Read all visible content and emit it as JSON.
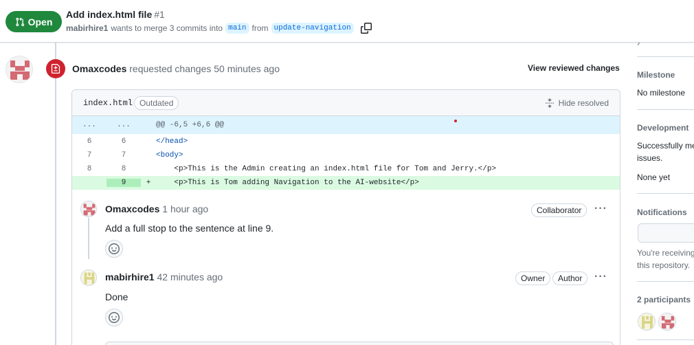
{
  "header": {
    "state": "Open",
    "title": "Add index.html file",
    "number": "#1",
    "author": "mabirhire1",
    "merge_text": "wants to merge 3 commits into",
    "base_branch": "main",
    "from_text": "from",
    "head_branch": "update-navigation"
  },
  "review": {
    "reviewer": "Omaxcodes",
    "action": "requested changes",
    "time": "50 minutes ago",
    "view_reviewed": "View reviewed changes"
  },
  "file": {
    "name": "index.html",
    "badge": "Outdated",
    "hide_resolved": "Hide resolved",
    "hunk": {
      "left": "...",
      "right": "...",
      "text": "@@ -6,5 +6,6 @@"
    },
    "lines": [
      {
        "old": "6",
        "new": "6",
        "marker": "",
        "code": "</head>"
      },
      {
        "old": "7",
        "new": "7",
        "marker": "",
        "code": "<body>"
      },
      {
        "old": "8",
        "new": "8",
        "marker": "",
        "code": "    <p>This is the Admin creating an index.html file for Tom and Jerry.</p>"
      },
      {
        "old": "",
        "new": "9",
        "marker": "+",
        "code": "    <p>This is Tom adding Navigation to the AI-website</p>"
      }
    ]
  },
  "comments": [
    {
      "author": "Omaxcodes",
      "time": "1 hour ago",
      "badges": [
        "Collaborator"
      ],
      "body": "Add a full stop to the sentence at line 9.",
      "menu": "···"
    },
    {
      "author": "mabirhire1",
      "time": "42 minutes ago",
      "badges": [
        "Owner",
        "Author"
      ],
      "body": "Done",
      "menu": "···"
    }
  ],
  "sidebar": {
    "clipped_text": "y",
    "milestone_heading": "Milestone",
    "milestone_value": "No milestone",
    "development_heading": "Development",
    "development_line1": "Successfully me",
    "development_line2": "issues.",
    "development_value": "None yet",
    "notifications_heading": "Notifications",
    "notifications_line1": "You're receiving",
    "notifications_line2": "this repository.",
    "participants_heading": "2 participants"
  },
  "colors": {
    "open_green": "#1f883d",
    "changes_red": "#cf222e",
    "addition_bg": "#dafbe1",
    "hunk_bg": "#ddf4ff"
  }
}
